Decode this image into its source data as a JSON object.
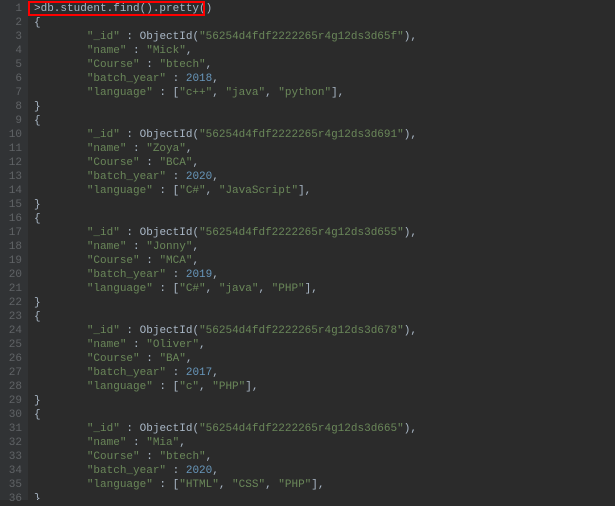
{
  "command": ">db.student.find().pretty()",
  "records": [
    {
      "_id": "56254d4fdf2222265r4g12ds3d65f",
      "name": "Mick",
      "course": "btech",
      "batch_year": 2018,
      "language": [
        "c++",
        "java",
        "python"
      ]
    },
    {
      "_id": "56254d4fdf2222265r4g12ds3d691",
      "name": "Zoya",
      "course": "BCA",
      "batch_year": 2020,
      "language": [
        "C#",
        "JavaScript"
      ]
    },
    {
      "_id": "56254d4fdf2222265r4g12ds3d655",
      "name": "Jonny",
      "course": "MCA",
      "batch_year": 2019,
      "language": [
        "C#",
        "java",
        "PHP"
      ]
    },
    {
      "_id": "56254d4fdf2222265r4g12ds3d678",
      "name": "Oliver",
      "course": "BA",
      "batch_year": 2017,
      "language": [
        "c",
        "PHP"
      ]
    },
    {
      "_id": "56254d4fdf2222265r4g12ds3d665",
      "name": "Mia",
      "course": "btech",
      "batch_year": 2020,
      "language": [
        "HTML",
        "CSS",
        "PHP"
      ]
    }
  ]
}
